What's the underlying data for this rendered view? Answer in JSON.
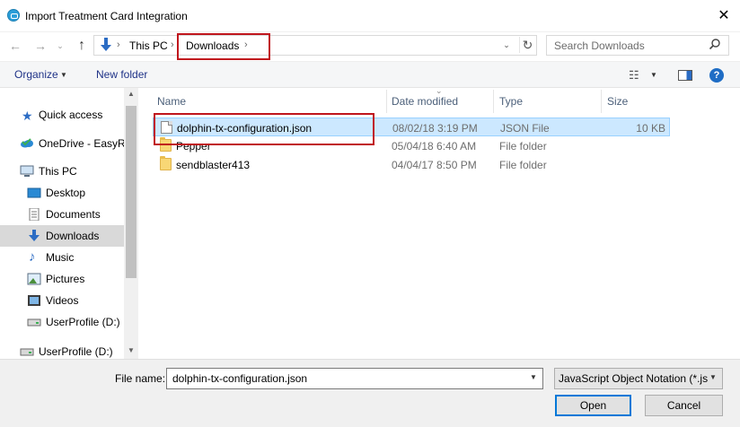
{
  "window": {
    "title": "Import Treatment Card Integration",
    "close_glyph": "✕"
  },
  "address": {
    "crumbs": [
      "This PC",
      "Downloads"
    ],
    "separator_glyph": "›",
    "search_placeholder": "Search Downloads"
  },
  "toolbar": {
    "organize_label": "Organize",
    "new_folder_label": "New folder",
    "help_glyph": "?"
  },
  "sidebar": {
    "items": [
      {
        "label": "Quick access",
        "icon": "star-icon"
      },
      {
        "label": "OneDrive - EasyRx",
        "icon": "cloud-icon"
      },
      {
        "label": "This PC",
        "icon": "computer-icon"
      },
      {
        "label": "Desktop",
        "icon": "desktop-icon"
      },
      {
        "label": "Documents",
        "icon": "documents-icon"
      },
      {
        "label": "Downloads",
        "icon": "download-arrow-icon",
        "selected": true
      },
      {
        "label": "Music",
        "icon": "music-note-icon"
      },
      {
        "label": "Pictures",
        "icon": "pictures-icon"
      },
      {
        "label": "Videos",
        "icon": "videos-icon"
      },
      {
        "label": "UserProfile (D:)",
        "icon": "drive-icon"
      },
      {
        "label": "UserProfile (D:)",
        "icon": "drive-icon"
      }
    ]
  },
  "file_list": {
    "columns": [
      "Name",
      "Date modified",
      "Type",
      "Size"
    ],
    "rows": [
      {
        "name": "dolphin-tx-configuration.json",
        "date": "08/02/18 3:19 PM",
        "type": "JSON File",
        "size": "10 KB",
        "icon": "json-file-icon",
        "selected": true
      },
      {
        "name": "Pepper",
        "date": "05/04/18 6:40 AM",
        "type": "File folder",
        "size": "",
        "icon": "folder-icon"
      },
      {
        "name": "sendblaster413",
        "date": "04/04/17 8:50 PM",
        "type": "File folder",
        "size": "",
        "icon": "folder-icon"
      }
    ]
  },
  "footer": {
    "file_name_label": "File name:",
    "file_name_value": "dolphin-tx-configuration.json",
    "file_type_value": "JavaScript Object Notation (*.js",
    "open_label": "Open",
    "cancel_label": "Cancel"
  },
  "colors": {
    "selection_bg": "#cce8ff",
    "annotation_red": "#c0161d",
    "accent_blue": "#0078d7"
  }
}
